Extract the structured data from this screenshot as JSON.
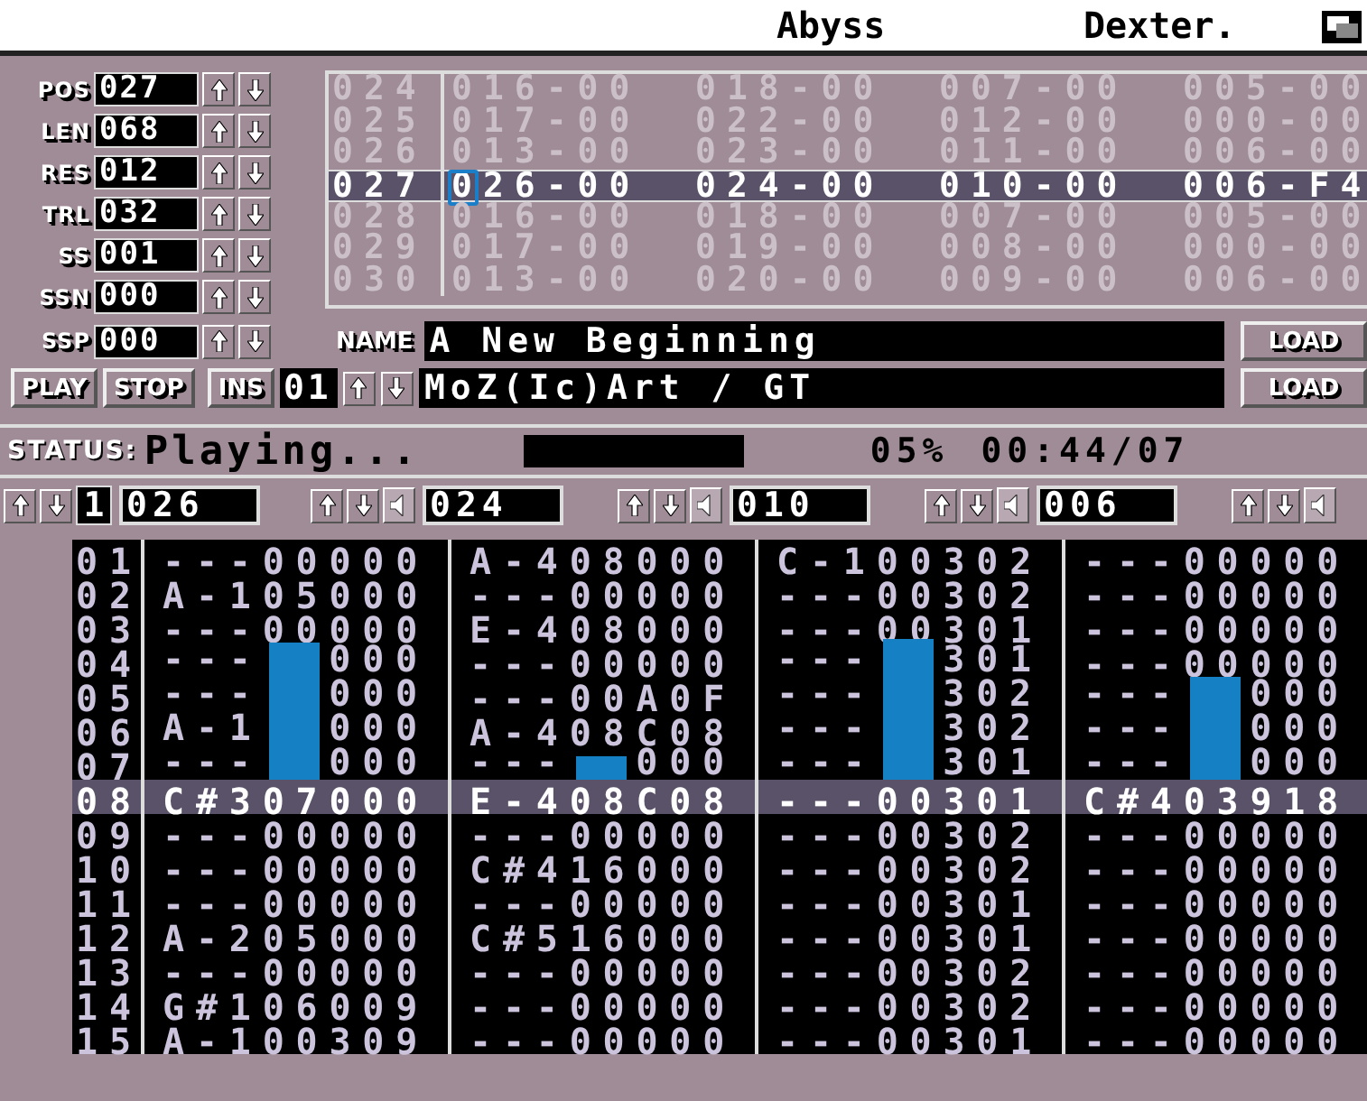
{
  "header": {
    "title": "Abyss",
    "author": "Dexter."
  },
  "params": [
    {
      "label": "POS",
      "value": "027"
    },
    {
      "label": "LEN",
      "value": "068"
    },
    {
      "label": "RES",
      "value": "012"
    },
    {
      "label": "TRL",
      "value": "032"
    },
    {
      "label": "SS",
      "value": "001"
    },
    {
      "label": "SSN",
      "value": "000"
    },
    {
      "label": "SSP",
      "value": "000"
    }
  ],
  "positions": [
    {
      "index": "024",
      "tracks": [
        "016-00",
        "018-00",
        "007-00",
        "005-00"
      ],
      "selected": false,
      "cursor": false
    },
    {
      "index": "025",
      "tracks": [
        "017-00",
        "022-00",
        "012-00",
        "000-00"
      ],
      "selected": false,
      "cursor": false
    },
    {
      "index": "026",
      "tracks": [
        "013-00",
        "023-00",
        "011-00",
        "006-00"
      ],
      "selected": false,
      "cursor": false
    },
    {
      "index": "027",
      "tracks": [
        "026-00",
        "024-00",
        "010-00",
        "006-F4"
      ],
      "selected": true,
      "cursor": true
    },
    {
      "index": "028",
      "tracks": [
        "016-00",
        "018-00",
        "007-00",
        "005-00"
      ],
      "selected": false,
      "cursor": false
    },
    {
      "index": "029",
      "tracks": [
        "017-00",
        "019-00",
        "008-00",
        "000-00"
      ],
      "selected": false,
      "cursor": false
    },
    {
      "index": "030",
      "tracks": [
        "013-00",
        "020-00",
        "009-00",
        "006-00"
      ],
      "selected": false,
      "cursor": false
    }
  ],
  "song_name": {
    "label": "NAME",
    "value": "A New Beginning",
    "button": "LOAD"
  },
  "transport": [
    "PLAY",
    "STOP"
  ],
  "instrument": {
    "label": "INS",
    "number": "01",
    "name": "MoZ(Ic)Art / GT",
    "button": "LOAD"
  },
  "status": {
    "label": "STATUS:",
    "text": "Playing...",
    "percent": "05%",
    "time": "00:44/07"
  },
  "channel_headers": [
    {
      "kind": "number",
      "label": "1",
      "track": "026"
    },
    {
      "kind": "speaker",
      "track": "024"
    },
    {
      "kind": "speaker",
      "track": "010"
    },
    {
      "kind": "speaker",
      "track": "006"
    },
    {
      "kind": "speaker"
    }
  ],
  "vu_meters": [
    {
      "level": 0.57
    },
    {
      "level": 0.1
    },
    {
      "level": 0.59
    },
    {
      "level": 0.43
    }
  ],
  "pattern": [
    {
      "row": "01",
      "selected": false,
      "cells": [
        "---00000",
        "A-408000",
        "C-100302",
        "---00000"
      ]
    },
    {
      "row": "02",
      "selected": false,
      "cells": [
        "A-105000",
        "---00000",
        "---00302",
        "---00000"
      ]
    },
    {
      "row": "03",
      "selected": false,
      "cells": [
        "---00000",
        "E-408000",
        "---00301",
        "---00000"
      ]
    },
    {
      "row": "04",
      "selected": false,
      "cells": [
        [
          "---",
          "000"
        ],
        "---00000",
        [
          "---",
          "301"
        ],
        "---00000"
      ]
    },
    {
      "row": "05",
      "selected": false,
      "cells": [
        [
          "---",
          "000"
        ],
        "---00A0F",
        [
          "---",
          "302"
        ],
        [
          "---",
          "000"
        ]
      ]
    },
    {
      "row": "06",
      "selected": false,
      "cells": [
        [
          "A-1",
          "000"
        ],
        "A-408C08",
        [
          "---",
          "302"
        ],
        [
          "---",
          "000"
        ]
      ]
    },
    {
      "row": "07",
      "selected": false,
      "cells": [
        [
          "---",
          "000"
        ],
        [
          "---",
          "000"
        ],
        [
          "---",
          "301"
        ],
        [
          "---",
          "000"
        ]
      ]
    },
    {
      "row": "08",
      "selected": true,
      "cells": [
        "C#307000",
        "E-408C08",
        "---00301",
        "C#403918"
      ]
    },
    {
      "row": "09",
      "selected": false,
      "cells": [
        "---00000",
        "---00000",
        "---00302",
        "---00000"
      ]
    },
    {
      "row": "10",
      "selected": false,
      "cells": [
        "---00000",
        "C#416000",
        "---00302",
        "---00000"
      ]
    },
    {
      "row": "11",
      "selected": false,
      "cells": [
        "---00000",
        "---00000",
        "---00301",
        "---00000"
      ]
    },
    {
      "row": "12",
      "selected": false,
      "cells": [
        "A-205000",
        "C#516000",
        "---00301",
        "---00000"
      ]
    },
    {
      "row": "13",
      "selected": false,
      "cells": [
        "---00000",
        "---00000",
        "---00302",
        "---00000"
      ]
    },
    {
      "row": "14",
      "selected": false,
      "cells": [
        "G#106009",
        "---00000",
        "---00302",
        "---00000"
      ]
    },
    {
      "row": "15",
      "selected": false,
      "cells": [
        "A-100309",
        "---00000",
        "---00301",
        "---00000"
      ]
    }
  ]
}
